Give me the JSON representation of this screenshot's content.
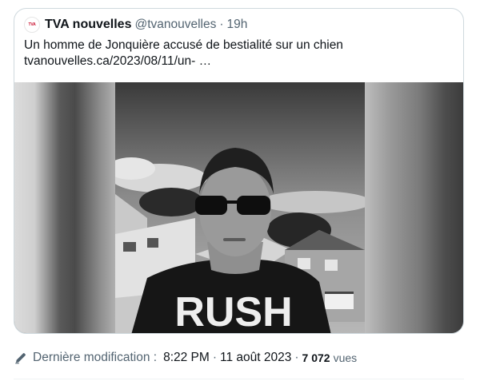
{
  "tweet": {
    "author_name": "TVA nouvelles",
    "author_handle": "@tvanouvelles",
    "separator": "·",
    "time": "19h",
    "avatar_text": "TVA",
    "text_line1": "Un homme de Jonquière accusé de bestialité sur un chien",
    "text_line2": "tvanouvelles.ca/2023/08/11/un- …",
    "image_shirt_text": "RUSH"
  },
  "meta": {
    "edit_label": "Dernière modification :",
    "time": "8:22 PM",
    "separator": "·",
    "date": "11 août 2023",
    "separator2": "·",
    "views_count": "7 072",
    "views_label": "vues"
  },
  "icons": {
    "pencil": "pencil-icon",
    "avatar": "tva-logo-icon"
  },
  "colors": {
    "text": "#0f1419",
    "secondary": "#536471",
    "border": "#cfd9de",
    "brand": "#c8102e"
  }
}
